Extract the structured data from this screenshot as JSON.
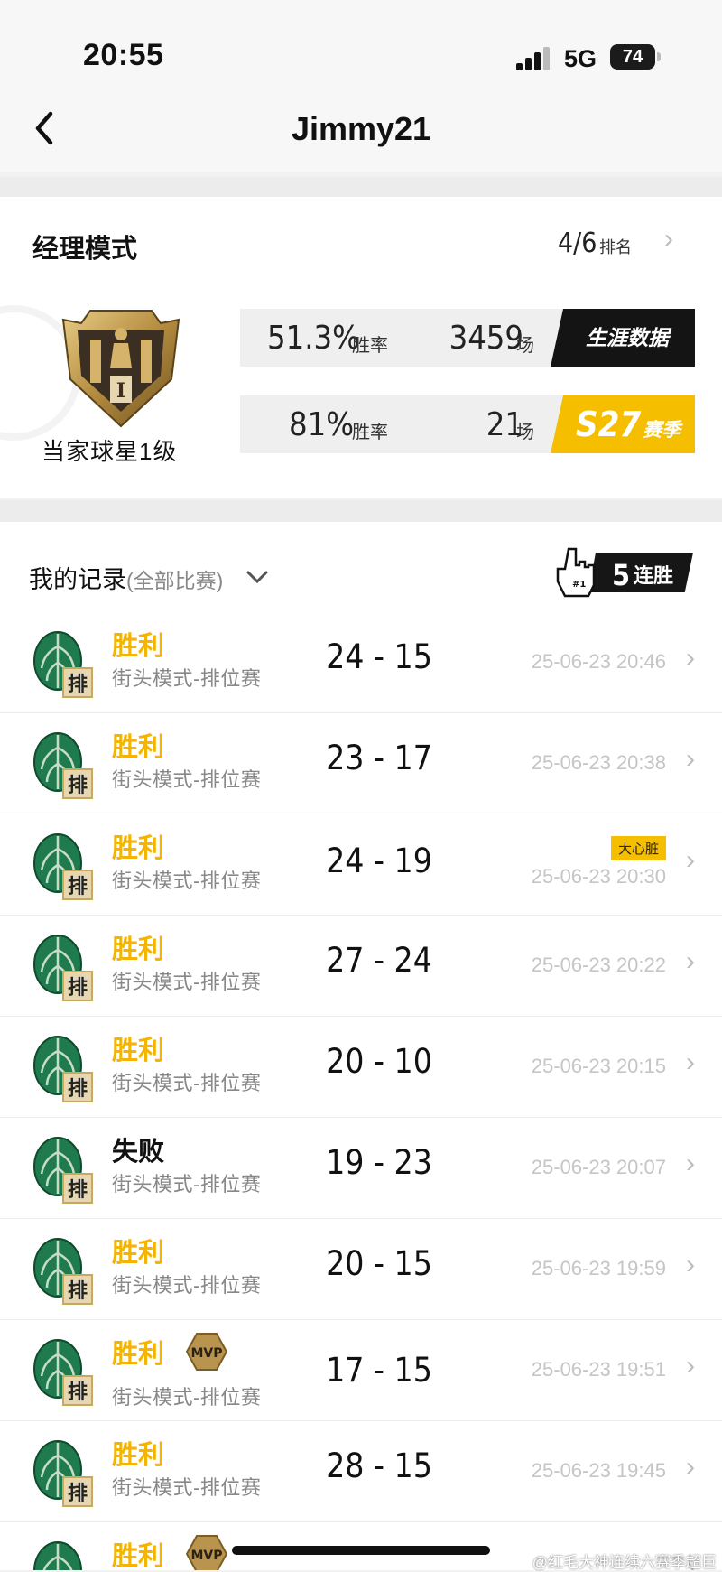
{
  "status_bar": {
    "time": "20:55",
    "network": "5G",
    "battery": "74"
  },
  "header": {
    "title": "Jimmy21"
  },
  "manager": {
    "title": "经理模式",
    "rank_value": "4/6",
    "rank_label": "排名",
    "badge_label": "当家球星1级",
    "career": {
      "win_rate": "51.3%",
      "win_rate_label": "胜率",
      "games": "3459",
      "games_label": "场",
      "tag": "生涯数据"
    },
    "season": {
      "win_rate": "81%",
      "win_rate_label": "胜率",
      "games": "21",
      "games_label": "场",
      "tag_number": "S27",
      "tag_label": "赛季"
    }
  },
  "records": {
    "title": "我的记录",
    "filter": "(全部比赛)",
    "streak_count": "5",
    "streak_label": "连胜",
    "items": [
      {
        "result": "胜利",
        "mode": "街头模式-排位赛",
        "score": "24 - 15",
        "date": "25-06-23 20:46",
        "win": true
      },
      {
        "result": "胜利",
        "mode": "街头模式-排位赛",
        "score": "23 - 17",
        "date": "25-06-23 20:38",
        "win": true
      },
      {
        "result": "胜利",
        "mode": "街头模式-排位赛",
        "score": "24 - 19",
        "date": "25-06-23 20:30",
        "win": true,
        "tag": "大心脏"
      },
      {
        "result": "胜利",
        "mode": "街头模式-排位赛",
        "score": "27 - 24",
        "date": "25-06-23 20:22",
        "win": true
      },
      {
        "result": "胜利",
        "mode": "街头模式-排位赛",
        "score": "20 - 10",
        "date": "25-06-23 20:15",
        "win": true
      },
      {
        "result": "失败",
        "mode": "街头模式-排位赛",
        "score": "19 - 23",
        "date": "25-06-23 20:07",
        "win": false
      },
      {
        "result": "胜利",
        "mode": "街头模式-排位赛",
        "score": "20 - 15",
        "date": "25-06-23 19:59",
        "win": true
      },
      {
        "result": "胜利",
        "mode": "街头模式-排位赛",
        "score": "17 - 15",
        "date": "25-06-23 19:51",
        "win": true,
        "mvp": "MVP"
      },
      {
        "result": "胜利",
        "mode": "街头模式-排位赛",
        "score": "28 - 15",
        "date": "25-06-23 19:45",
        "win": true
      },
      {
        "result": "胜利",
        "mode": "",
        "score": "",
        "date": "",
        "win": true,
        "mvp": "MVP"
      }
    ]
  },
  "leaf_badge_char": "排",
  "watermark": "@红毛大神连续六赛季超巨",
  "colors": {
    "win": "#f5b400",
    "season_tag": "#f5bf00",
    "career_tag": "#141414",
    "leaf_green": "#1f7a4d",
    "leaf_gold": "#c9a75c"
  },
  "icons": [
    "back-chevron-icon",
    "signal-icon",
    "battery-icon",
    "chevron-right-icon",
    "chevron-down-icon",
    "foam-finger-icon",
    "leaf-rank-icon",
    "mvp-badge-icon",
    "star-player-badge-icon"
  ]
}
